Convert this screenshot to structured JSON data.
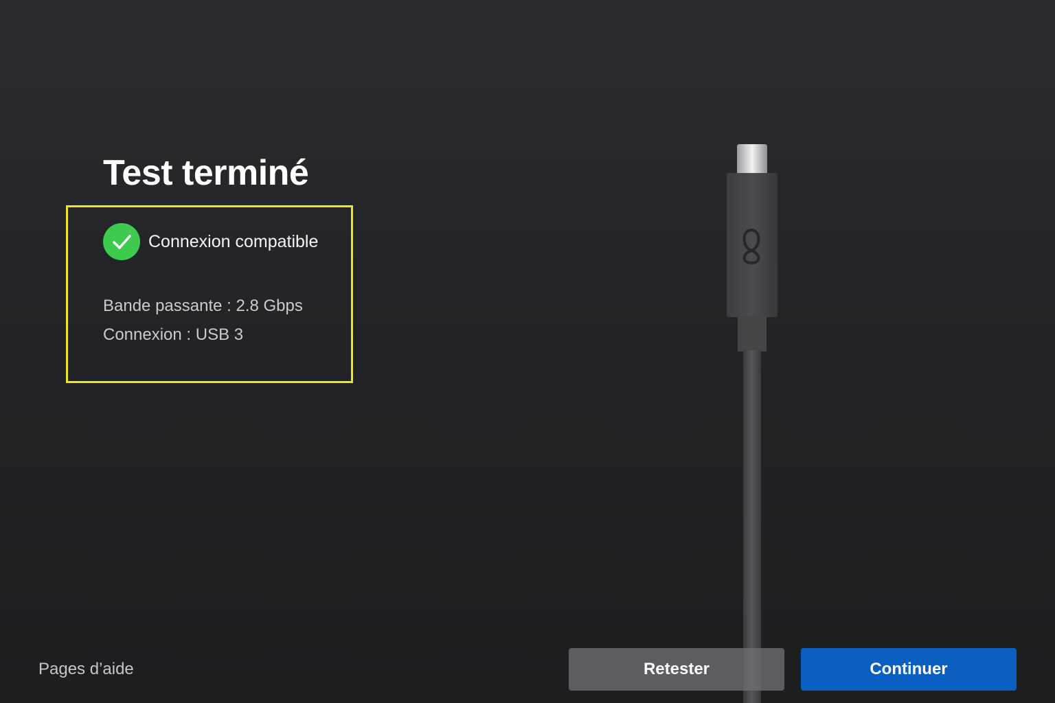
{
  "page": {
    "title": "Test terminé"
  },
  "result": {
    "status_icon": "check-circle-icon",
    "status_color": "#3ec94f",
    "highlight_color": "#f2e61c",
    "status_label": "Connexion compatible",
    "bandwidth": "Bande passante : 2.8 Gbps",
    "connection": "Connexion : USB 3"
  },
  "illustration": {
    "name": "usb-c-cable-icon",
    "logo": "meta-logo-icon"
  },
  "footer": {
    "help_link": "Pages d’aide",
    "retest_label": "Retester",
    "continue_label": "Continuer",
    "continue_color": "#0a5fc0"
  }
}
